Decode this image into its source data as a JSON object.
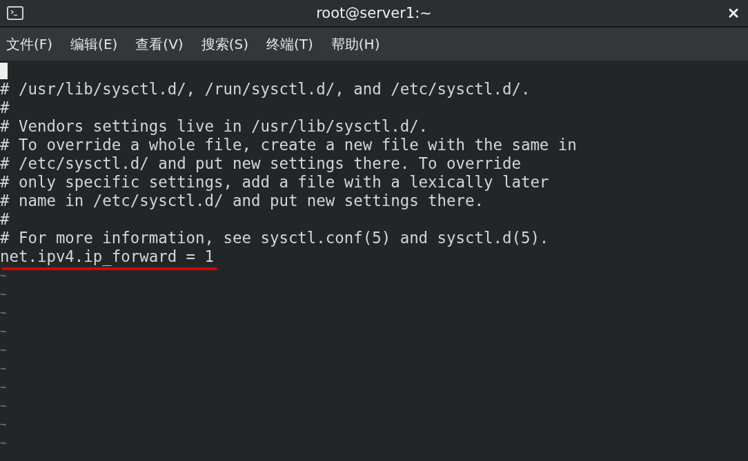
{
  "window": {
    "title": "root@server1:~"
  },
  "menu": [
    "文件(F)",
    "编辑(E)",
    "查看(V)",
    "搜索(S)",
    "终端(T)",
    "帮助(H)"
  ],
  "lines": [
    {
      "kind": "cursor"
    },
    {
      "kind": "text",
      "text": "# /usr/lib/sysctl.d/, /run/sysctl.d/, and /etc/sysctl.d/."
    },
    {
      "kind": "text",
      "text": "#"
    },
    {
      "kind": "text",
      "text": "# Vendors settings live in /usr/lib/sysctl.d/."
    },
    {
      "kind": "text",
      "text": "# To override a whole file, create a new file with the same in"
    },
    {
      "kind": "text",
      "text": "# /etc/sysctl.d/ and put new settings there. To override"
    },
    {
      "kind": "text",
      "text": "# only specific settings, add a file with a lexically later"
    },
    {
      "kind": "text",
      "text": "# name in /etc/sysctl.d/ and put new settings there."
    },
    {
      "kind": "text",
      "text": "#"
    },
    {
      "kind": "text",
      "text": "# For more information, see sysctl.conf(5) and sysctl.d(5)."
    },
    {
      "kind": "underlined",
      "text": "net.ipv4.ip_forward = 1"
    },
    {
      "kind": "filler",
      "text": "~"
    },
    {
      "kind": "filler",
      "text": "~"
    },
    {
      "kind": "filler",
      "text": "~"
    },
    {
      "kind": "filler",
      "text": "~"
    },
    {
      "kind": "filler",
      "text": "~"
    },
    {
      "kind": "filler",
      "text": "~"
    },
    {
      "kind": "filler",
      "text": "~"
    },
    {
      "kind": "filler",
      "text": "~"
    },
    {
      "kind": "filler",
      "text": "~"
    },
    {
      "kind": "filler",
      "text": "~"
    }
  ]
}
